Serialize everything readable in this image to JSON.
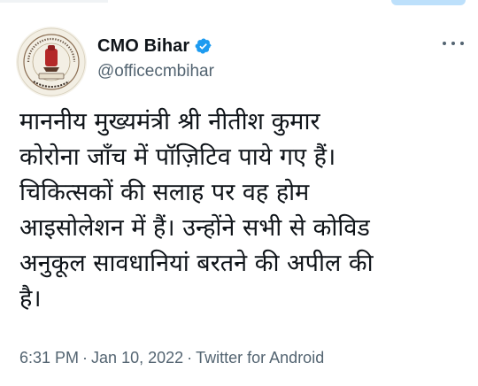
{
  "tweet": {
    "author": {
      "display_name": "CMO Bihar",
      "handle": "@officecmbihar",
      "verified": true,
      "avatar": "chief-minister-secretariat-seal"
    },
    "text": "माननीय मुख्यमंत्री श्री नीतीश कुमार\nकोरोना जाँच में पॉज़िटिव पाये गए हैं।\nचिकित्सकों की सलाह पर वह होम\nआइसोलेशन में हैं। उन्होंने सभी से कोविड\nअनुकूल सावधानियां बरतने की अपील की\nहै।",
    "time": "6:31 PM",
    "date": "Jan 10, 2022",
    "source": "Twitter for Android",
    "separator": "·"
  },
  "icons": {
    "verified_badge": "verified-check",
    "more": "more-horizontal"
  },
  "colors": {
    "verified_blue": "#1d9bf0",
    "secondary_text": "#536471",
    "primary_text": "#0f1419"
  }
}
